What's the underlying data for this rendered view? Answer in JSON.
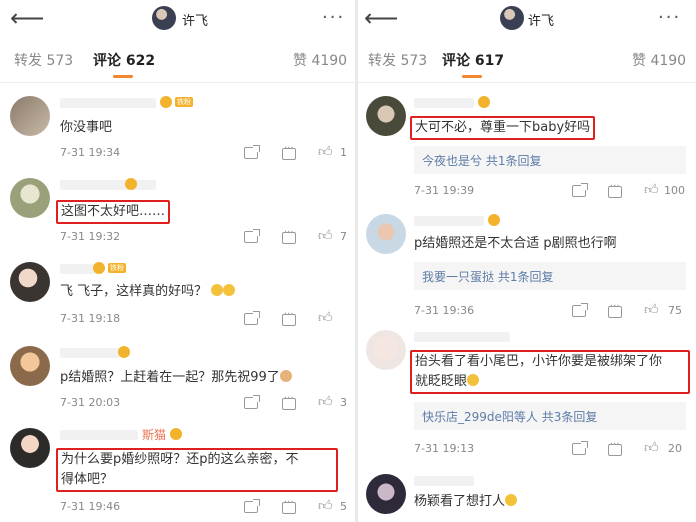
{
  "left": {
    "title": "许飞",
    "tabs": {
      "repost": "转发 573",
      "comment": "评论 622",
      "likes": "赞 4190"
    },
    "comments": [
      {
        "text": "你没事吧",
        "time": "7-31 19:34",
        "likes": "1",
        "highlighted": false
      },
      {
        "text": "这图不太好吧……",
        "time": "7-31 19:32",
        "likes": "7",
        "highlighted": true
      },
      {
        "text": "飞 飞子，这样真的好吗？",
        "time": "7-31 19:18",
        "likes": "",
        "highlighted": false
      },
      {
        "text": "p结婚照？上赶着在一起？那先祝99了",
        "time": "7-31 20:03",
        "likes": "3",
        "highlighted": false
      },
      {
        "nickname": "斯猫",
        "text_line1": "为什么要p婚纱照呀？还p的这么亲密，不",
        "text_line2": "得体吧？",
        "time": "7-31 19:46",
        "likes": "5",
        "highlighted": true
      }
    ]
  },
  "right": {
    "title": "许飞",
    "tabs": {
      "repost": "转发 573",
      "comment": "评论 617",
      "likes": "赞 4190"
    },
    "comments": [
      {
        "text": "大可不必，尊重一下baby好吗",
        "reply": "今夜也是兮  共1条回复",
        "time": "7-31 19:39",
        "likes": "100",
        "highlighted": true
      },
      {
        "text": "p结婚照还是不太合适  p剧照也行啊",
        "reply": "我要一只蛋挞  共1条回复",
        "time": "7-31 19:36",
        "likes": "75",
        "highlighted": false
      },
      {
        "text_line1": "抬头看了看小尾巴，小许你要是被绑架了你",
        "text_line2": "就眨眨眼",
        "reply": "快乐店_299de阳等人  共3条回复",
        "time": "7-31 19:13",
        "likes": "20",
        "highlighted": true
      },
      {
        "text": "杨颖看了想打人",
        "highlighted": false
      }
    ]
  },
  "icons": {
    "back": "back-arrow-icon",
    "more": "more-icon",
    "share": "share-icon",
    "reply": "reply-icon",
    "like": "thumb-up-icon",
    "badge": "member-badge-icon"
  },
  "colors": {
    "accent": "#f3872c",
    "highlight_box": "#e02020",
    "link": "#5d7ca6",
    "nickname": "#eb7350"
  }
}
